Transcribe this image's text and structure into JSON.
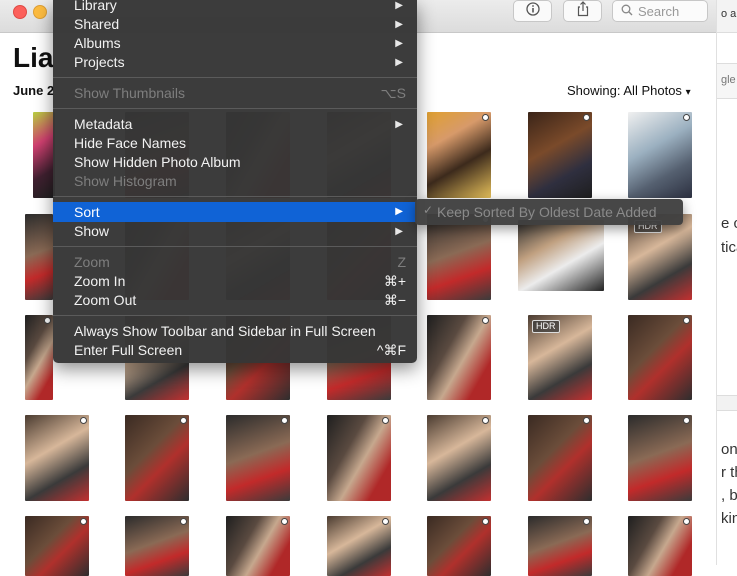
{
  "window": {
    "search_placeholder": "Search"
  },
  "header": {
    "album_title": "Lia",
    "date_label": "June 2",
    "showing_label": "Showing:",
    "showing_value": "All Photos"
  },
  "menu": {
    "items": [
      {
        "label": "Library",
        "submenu": true,
        "enabled": true
      },
      {
        "label": "Shared",
        "submenu": true,
        "enabled": true
      },
      {
        "label": "Albums",
        "submenu": true,
        "enabled": true
      },
      {
        "label": "Projects",
        "submenu": true,
        "enabled": true
      },
      {
        "label": "Show Thumbnails",
        "shortcut": "⌥S",
        "enabled": false
      },
      {
        "label": "Metadata",
        "submenu": true,
        "enabled": true
      },
      {
        "label": "Hide Face Names",
        "enabled": true
      },
      {
        "label": "Show Hidden Photo Album",
        "enabled": true
      },
      {
        "label": "Show Histogram",
        "enabled": false
      },
      {
        "label": "Sort",
        "submenu": true,
        "enabled": true,
        "highlighted": true
      },
      {
        "label": "Show",
        "submenu": true,
        "enabled": true
      },
      {
        "label": "Zoom",
        "shortcut": "Z",
        "enabled": false
      },
      {
        "label": "Zoom In",
        "shortcut": "⌘+",
        "enabled": true
      },
      {
        "label": "Zoom Out",
        "shortcut": "⌘−",
        "enabled": true
      },
      {
        "label": "Always Show Toolbar and Sidebar in Full Screen",
        "enabled": true
      },
      {
        "label": "Enter Full Screen",
        "shortcut": "^⌘F",
        "enabled": true
      }
    ],
    "sort_submenu": {
      "check": "✓",
      "label": "Keep Sorted By Oldest Date Added"
    }
  },
  "side_window": {
    "fragments": [
      "o a j",
      "gle D",
      "e c",
      "tica",
      "on",
      "r th",
      ", be",
      "kin"
    ]
  },
  "photos": {
    "hdr_badge": "HDR"
  },
  "colors": {
    "menu_bg": "#363636",
    "highlight": "#1063d6",
    "accent_red": "#c8242a"
  }
}
